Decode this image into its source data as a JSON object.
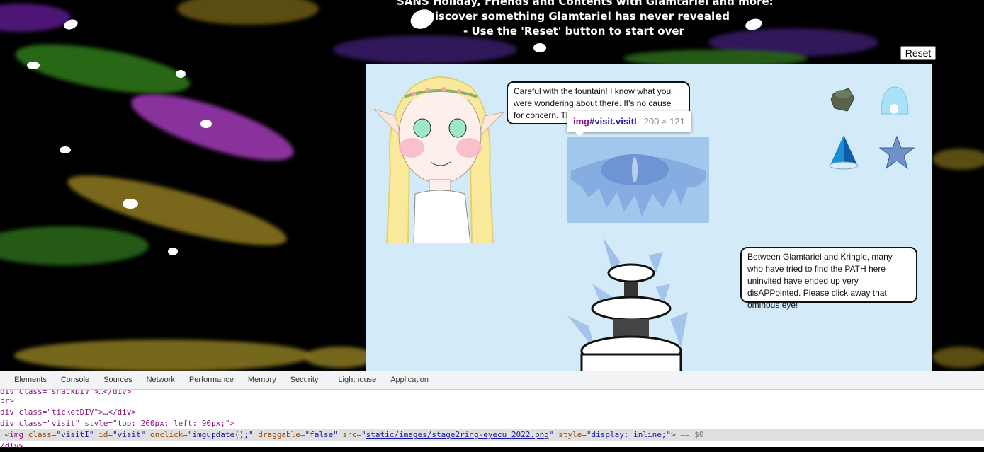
{
  "instructions": {
    "line1": "SANS Holiday, Friends and Contents with Glamtariel and more:",
    "line2": "- Discover something Glamtariel has never revealed",
    "line3": "- Use the 'Reset' button to start over"
  },
  "reset_label": "Reset",
  "bubbles": {
    "top": "Careful with the fountain! I know what you were wondering about there. It's no cause for concern. The PATH here is closed!",
    "right": "Between Glamtariel and Kringle, many who have tried to find the PATH here uninvited have ended up very disAPPointed. Please click away that ominous eye!"
  },
  "tooltip": {
    "tag": "img",
    "selector": "#visit.visitI",
    "size": "200 × 121"
  },
  "items": [
    "dark-ring-icon",
    "igloo-ring-icon",
    "blue-cone-icon",
    "blue-star-icon"
  ],
  "devtools": {
    "tabs": [
      "Elements",
      "Console",
      "Sources",
      "Network",
      "Performance",
      "Memory",
      "Security",
      "Lighthouse",
      "Application"
    ],
    "lines": {
      "l1_pre": "div class=\"snackDIV\">…</div>",
      "l2": "br>",
      "l3": "div class=\"ticketDIV\">…</div>",
      "l4": "div class=\"visit\" style=\"top: 260px; left: 90px;\">",
      "l5_tag": "<img",
      "l5_class_attr": " class=",
      "l5_class_val": "\"visitI\"",
      "l5_id_attr": " id=",
      "l5_id_val": "\"visit\"",
      "l5_onclick_attr": " onclick=",
      "l5_onclick_val": "\"imgupdate();\"",
      "l5_drag_attr": " draggable=",
      "l5_drag_val": "\"false\"",
      "l5_src_attr": " src=",
      "l5_src_q1": "\"",
      "l5_src_val": "static/images/stage2ring-eyecu_2022.png",
      "l5_src_q2": "\"",
      "l5_style_attr": " style=",
      "l5_style_val": "\"display: inline;\"",
      "l5_end": ">",
      "l5_eq": " == $0",
      "l6": "/div>"
    }
  }
}
